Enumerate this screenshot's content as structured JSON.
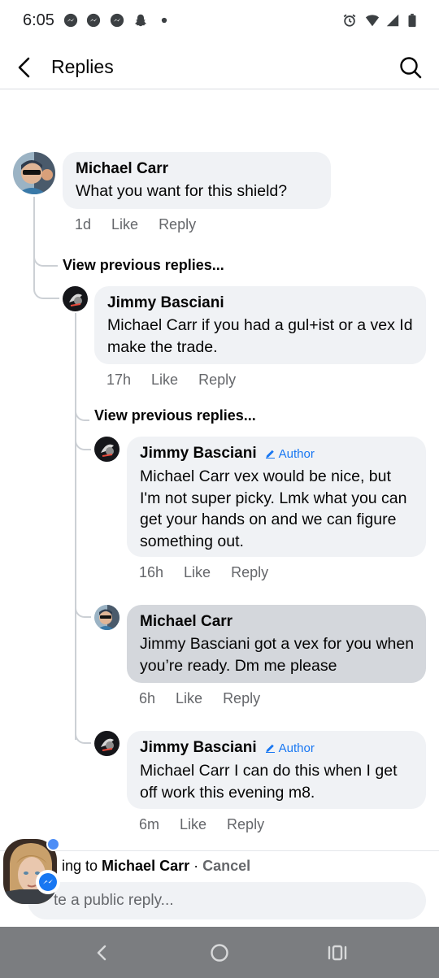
{
  "status_bar": {
    "time": "6:05",
    "left_icons": [
      "messenger-icon",
      "messenger-icon",
      "messenger-icon",
      "snapchat-icon",
      "dot-icon"
    ],
    "right_icons": [
      "alarm-icon",
      "wifi-icon",
      "signal-icon",
      "battery-icon"
    ]
  },
  "header": {
    "title": "Replies",
    "back_icon": "back-arrow-icon",
    "search_icon": "search-icon"
  },
  "comments": [
    {
      "author": "Michael Carr",
      "text": "What you want for this shield?",
      "time": "1d",
      "like": "Like",
      "reply": "Reply",
      "is_author": false
    },
    {
      "author": "Jimmy Basciani",
      "text": "Michael Carr if you had a gul+ist or a vex Id make the trade.",
      "time": "17h",
      "like": "Like",
      "reply": "Reply",
      "is_author": false
    },
    {
      "author": "Jimmy Basciani",
      "badge": "Author",
      "text": "Michael Carr vex would be nice, but I'm not super picky. Lmk what you can get your hands on and we can figure something out.",
      "time": "16h",
      "like": "Like",
      "reply": "Reply",
      "is_author": true
    },
    {
      "author": "Michael Carr",
      "text": "Jimmy Basciani got a vex for you when you’re ready. Dm me please",
      "time": "6h",
      "like": "Like",
      "reply": "Reply",
      "is_author": false,
      "highlighted": true
    },
    {
      "author": "Jimmy Basciani",
      "badge": "Author",
      "text": "Michael Carr I can do this when I get off work this evening m8.",
      "time": "6m",
      "like": "Like",
      "reply": "Reply",
      "is_author": true
    }
  ],
  "view_previous": [
    "View previous replies...",
    "View previous replies..."
  ],
  "composer": {
    "replying_prefix": "ing to ",
    "replying_name": "Michael Carr",
    "separator": " · ",
    "cancel": "Cancel",
    "placeholder": "te a public reply..."
  },
  "nav_bar": {
    "icons": [
      "nav-back-icon",
      "nav-home-icon",
      "nav-recents-icon"
    ]
  },
  "colors": {
    "link_blue": "#1877f2",
    "bubble_bg": "#f0f2f5",
    "bubble_highlight": "#d4d7dc",
    "meta_grey": "#65676b",
    "nav_bar_bg": "#7b7d80"
  }
}
